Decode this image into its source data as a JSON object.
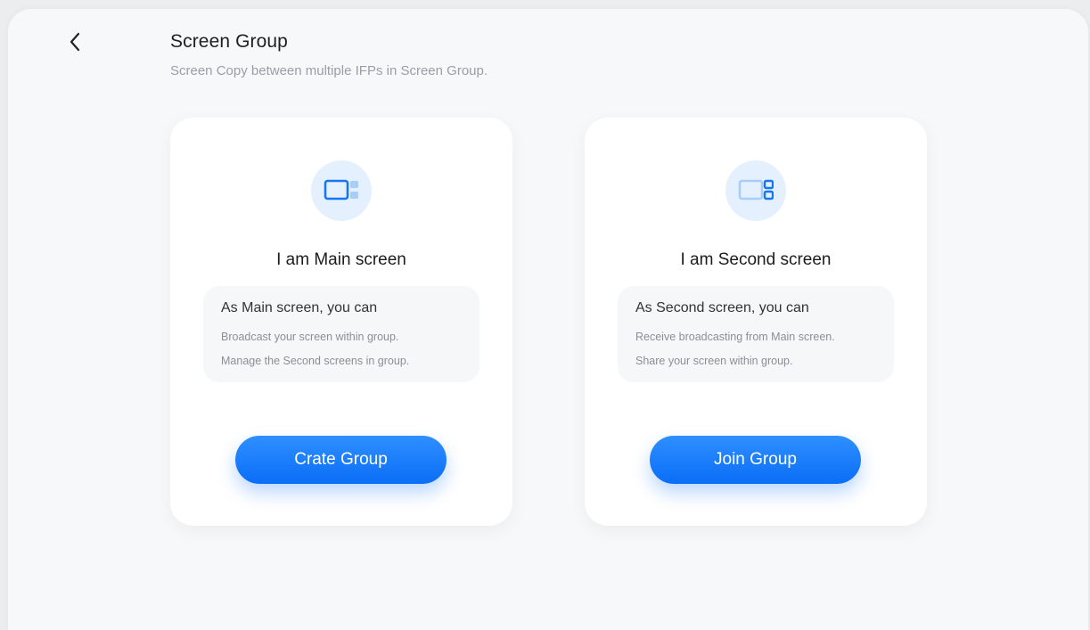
{
  "header": {
    "title": "Screen Group",
    "subtitle": "Screen Copy between multiple IFPs in Screen Group.",
    "back_icon": "chevron-left-icon"
  },
  "cards": {
    "main": {
      "icon": "main-screen-icon",
      "title": "I am Main screen",
      "info_heading": "As Main screen, you can",
      "info_lines": [
        "Broadcast your screen within group.",
        "Manage the Second screens in group."
      ],
      "button_label": "Crate Group"
    },
    "second": {
      "icon": "second-screen-icon",
      "title": "I am Second screen",
      "info_heading": "As Second screen, you can",
      "info_lines": [
        "Receive broadcasting from Main screen.",
        "Share your screen within group."
      ],
      "button_label": "Join Group"
    }
  },
  "colors": {
    "accent": "#0a6ef7",
    "icon_bg": "#e5f0fe",
    "background": "#f7f8f9"
  }
}
